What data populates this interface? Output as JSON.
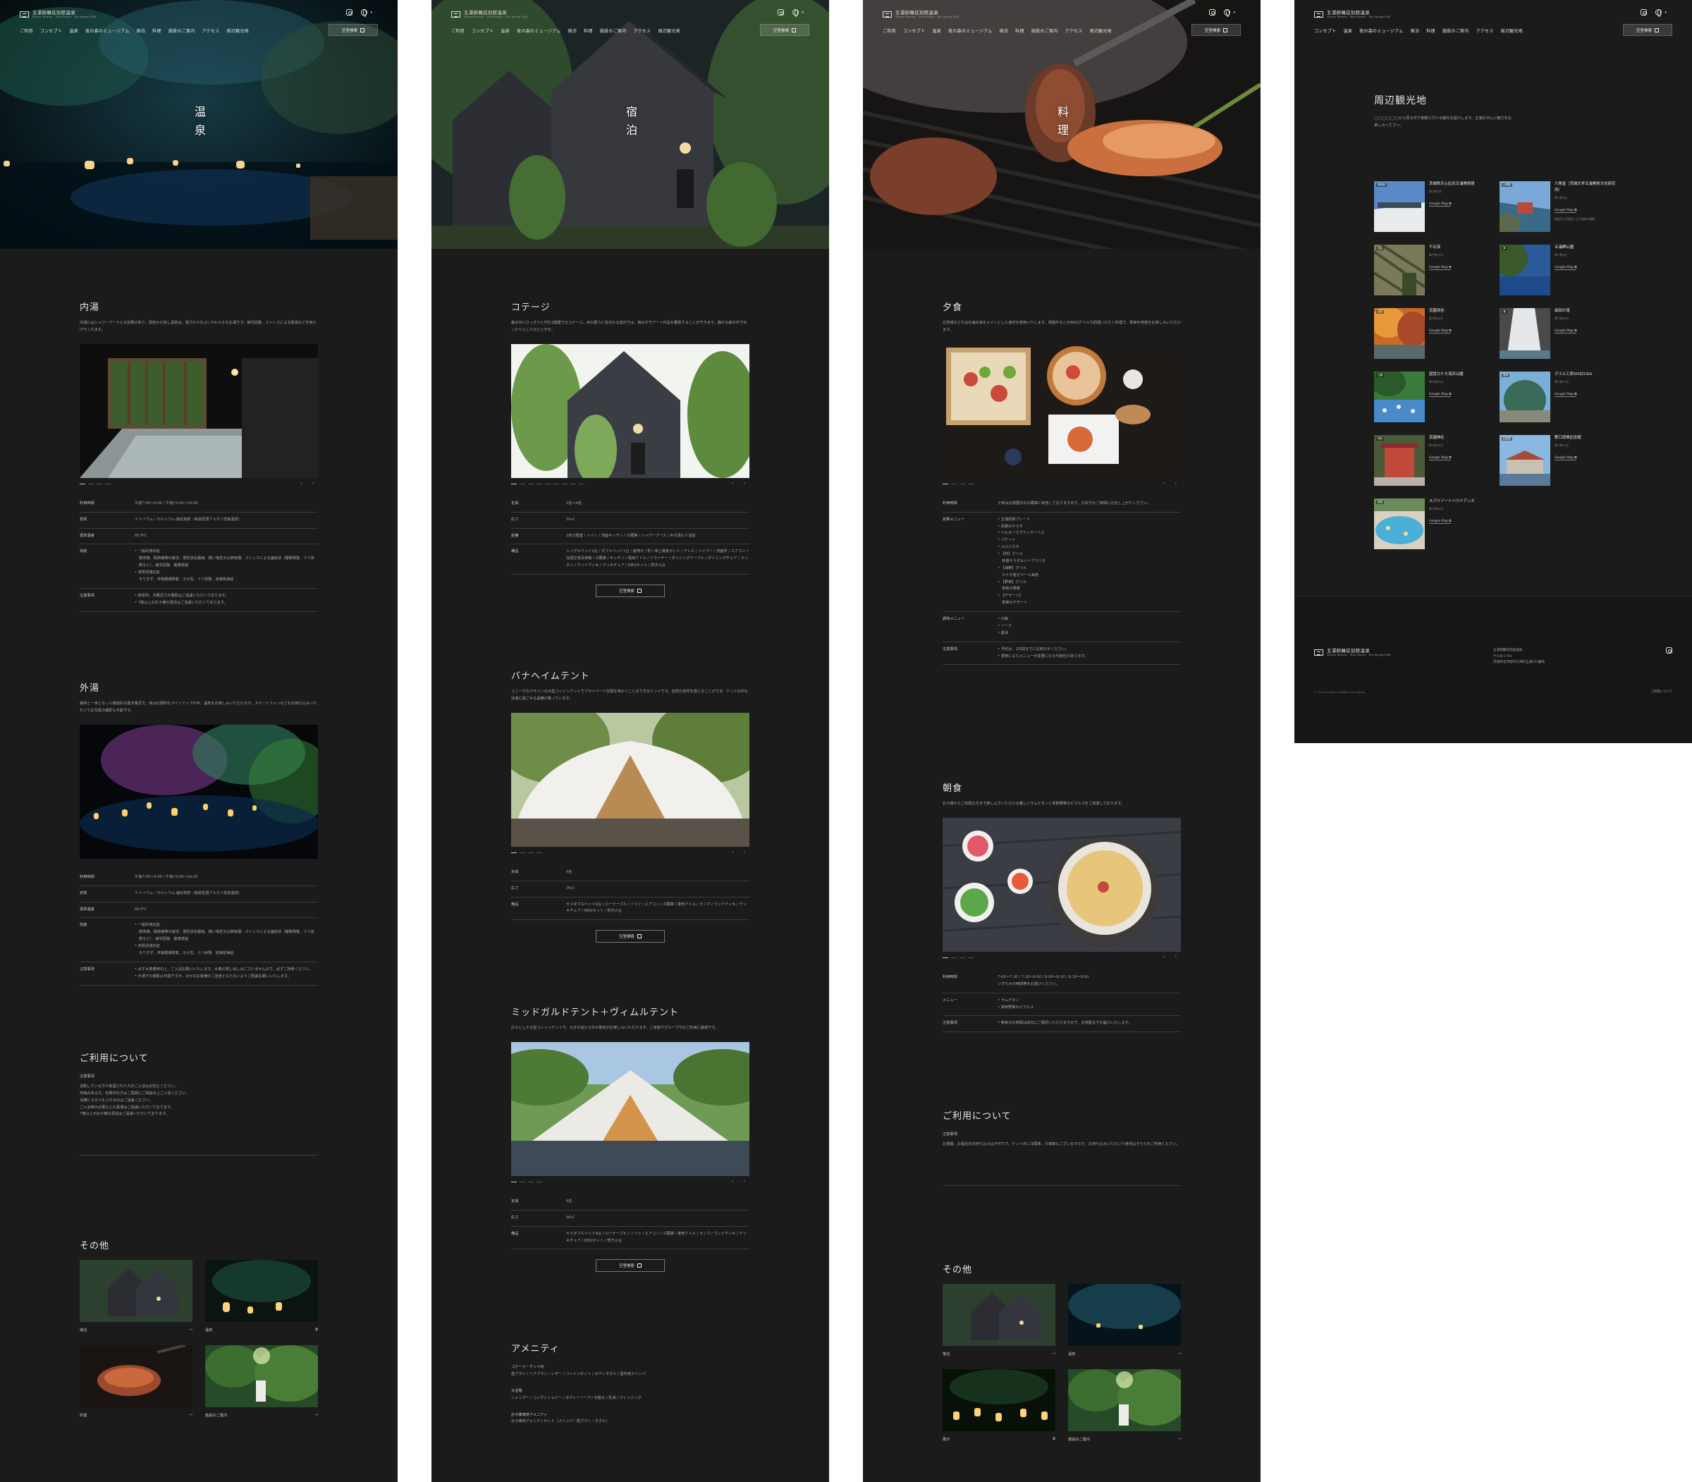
{
  "brand": {
    "name": "五浦俯瞰荘別館温泉",
    "sub": "Nature Retreat · Mori Resort · Hot Spring Villa"
  },
  "nav": [
    "ご利用",
    "コンセプト",
    "温泉",
    "夜の森のミュージアム",
    "宿泊",
    "料理",
    "施設のご案内",
    "アクセス",
    "周辺観光地"
  ],
  "nav_p4": [
    "コンセプト",
    "温泉",
    "夜の森のミュージアム",
    "宿泊",
    "料理",
    "施設のご案内",
    "アクセス",
    "周辺観光地"
  ],
  "vacancy_label": "空室検索",
  "spring": {
    "hero_title": "温泉",
    "inner": {
      "title": "内湯",
      "lead": "内湯にはシャワーブースと大浴場があり、源泉かけ流し温泉は、湯ざわりのよいやわらかなお湯です。疲労回復、ストレスによる緊張などを和らげてくれます。",
      "rows": [
        {
          "k": "利用時間",
          "v": [
            "午前7:00〜9:00 / 午後15:00〜24:00"
          ]
        },
        {
          "k": "泉質",
          "v": [
            "ナトリウム・カルシウム-塩化物泉（高張性弱アルカリ性高温泉）"
          ]
        },
        {
          "k": "源泉温度",
          "v": [
            "60.9℃"
          ]
        },
        {
          "k": "効能",
          "v": [
            "一般的適応症",
            "筋肉痛、関節痛等の疲労、慢性消化器病、軽い喘息又は肺気腫、ストレスによる諸症状（睡眠障害、うつ状態など）、疲労回復、健康増進",
            "泉質別適応症",
            "きりきず、末梢循環障害、冷え性、うつ状態、皮膚乾燥症"
          ]
        },
        {
          "k": "注意事項",
          "v": [
            "飲泉所、内風呂での撮影はご遠慮いただいております。",
            "7歳以上のお子様の混浴はご遠慮いただいております。"
          ]
        }
      ]
    },
    "outer": {
      "title": "外湯",
      "lead": "森林と一体となった開放的な露天風呂で、夜は幻想的なライトアップの中、温泉をお楽しみいただけます。スマートフォンなどをお持ち込みいただいてお写真の撮影も可能です。",
      "rows": [
        {
          "k": "利用時間",
          "v": [
            "午後7:00〜9:00 / 午後15:00〜24:00"
          ]
        },
        {
          "k": "泉質",
          "v": [
            "ナトリウム・カルシウム-塩化物泉（高張性弱アルカリ性高温泉）"
          ]
        },
        {
          "k": "源泉温度",
          "v": [
            "60.9℃"
          ]
        },
        {
          "k": "効能",
          "v": [
            "一般的適応症",
            "筋肉痛、関節痛等の疲労、慢性消化器病、軽い喘息又は肺気腫、ストレスによる諸症状（睡眠障害、うつ状態など）、疲労回復、健康増進",
            "泉質別適応症",
            "きりきず、末梢循環障害、冷え性、うつ状態、皮膚乾燥症"
          ]
        },
        {
          "k": "注意事項",
          "v": [
            "必ず水着着用の上、ご入浴お願いいたします。水着の貸し出しはございませんので、必ずご持参ください。",
            "外湯での撮影は可能ですが、ほかのお客様のご迷惑とならないようご配慮お願いいたします。"
          ]
        }
      ]
    },
    "usage": {
      "title": "ご利用について",
      "note_label": "注意事項",
      "items": [
        "泥酔している方や飲酒された方のご入浴はお控えください。",
        "持病のある方、妊娠中の方はご医師にご相談の上ご入浴ください。",
        "浴槽にタオルを入れるのはご遠慮ください。",
        "ご入浴時の必要以上の長湯はご遠慮いただいております。",
        "7歳以上のお子様の混浴はご遠慮いただいております。"
      ]
    },
    "others_title": "その他",
    "others": [
      "宿泊",
      "温泉",
      "料理",
      "施設のご案内"
    ]
  },
  "stay": {
    "hero_title": "宿泊",
    "cottage": {
      "title": "コテージ",
      "lead": "森の中にひっそりと佇む2階建てのコテージ。木の香りに包まれる室内では、森の中でアート作品を鑑賞することができます。静かな森の中でゆったりとしたひとときを。",
      "rows": [
        {
          "k": "定員",
          "v": [
            "2名〜4名"
          ]
        },
        {
          "k": "広さ",
          "v": [
            "50㎡"
          ]
        },
        {
          "k": "設備",
          "v": [
            "2名分寝室 / トイレ / 洗面キッチン / 冷蔵庫 / シャワーブース / 木の温もり浴室"
          ]
        },
        {
          "k": "備品",
          "v": [
            "シングルベッド2台 / ダブルベッド1台 / 座椅子 / 机 / 卓上電気ポット / テレビ / シャワー / 洗面所 / エアコン / 加湿空気清浄機 / 冷蔵庫 / キッチン / 電気ケトル / ドライヤー / ダイニングテーブル / ダイニングチェア / ランタン / ウッドデッキ / デッキチェア / BBQセット / 焚き火台"
          ]
        }
      ]
    },
    "banahem": {
      "title": "バナヘイムテント",
      "lead": "ユニークなデザインの大型コットンテントでプライベート空間を味わうことのできるテントです。自然の息吹を感じることができ、テントの中も快適に過ごせる設備が整っています。",
      "rows": [
        {
          "k": "定員",
          "v": [
            "4名"
          ]
        },
        {
          "k": "広さ",
          "v": [
            "36㎡"
          ]
        },
        {
          "k": "備品",
          "v": [
            "セミダブルベッド4台 / ローテーブル / ソファ / エアコン / 冷蔵庫 / 電気ケトル / ランプ / ウッドデッキ / デッキチェア / BBQセット / 焚き火台"
          ]
        }
      ]
    },
    "midgard": {
      "title": "ミッドガルドテント＋ヴィムルテント",
      "lead": "広々とした大型コットンテントで、大きな窓から外の景色がお楽しみいただけます。ご家族やグループでのご利用に最適です。",
      "rows": [
        {
          "k": "定員",
          "v": [
            "6名"
          ]
        },
        {
          "k": "広さ",
          "v": [
            "46㎡"
          ]
        },
        {
          "k": "備品",
          "v": [
            "セミダブルベッド4台 / ローテーブル / ソファ / エアコン / 冷蔵庫 / 電気ケトル / ランプ / ウッドデッキ / デッキチェア / BBQセット / 焚き火台"
          ]
        }
      ]
    },
    "amenity": {
      "title": "アメニティ",
      "groups": [
        {
          "k": "コテージ・テント内",
          "v": "歯ブラシ / ヘアブラシ / レザー / コットンセット / ボディタオル / 室内用スリッパ"
        },
        {
          "k": "大浴場",
          "v": "シャンプー / コンディショナー / ボディーソープ / 化粧水 / 乳液 / クレンジング"
        },
        {
          "k": "お子様専用アメニティ",
          "v": "お子様用アメニティセット（スリッパ・歯ブラシ・タオル）"
        }
      ]
    }
  },
  "food": {
    "hero_title": "料理",
    "dinner": {
      "title": "夕食",
      "lead": "北茨城ならではの海の幸をメインとした食材を使用いたします。常陸牛などのBBQグリルで調理いただく料理で、季節の味覚をお楽しみいただけます。",
      "rows": [
        {
          "k": "利用時間",
          "v": [
            "夕食はお部屋内の冷蔵庫に用意しておりますので、お好きなご時間にお召し上がりください。"
          ]
        },
        {
          "k": "前菜メニュー",
          "v": [
            "五浦前菜プレート",
            "前菜のサラダ",
            "ベルオーズブティサーベス",
            "バケット",
            "メロパスタ",
            "【肉】グリル",
            "特選サラダ＆ハーブマリネ",
            "【海鮮】グリル",
            "カナダ産オマール海老",
            "【野菜】グリル",
            "季節の野菜",
            "【デザート】",
            "季節のデザート"
          ]
        },
        {
          "k": "調味メニュー",
          "v": [
            "炒飯",
            "ソース",
            "醤油"
          ]
        },
        {
          "k": "注意事項",
          "v": [
            "予約は、2日前までにお知らせください。",
            "季節によりメニューが変更になる可能性があります。"
          ]
        }
      ]
    },
    "breakfast": {
      "title": "朝食",
      "lead": "お子様からご年配の方まで楽しんでいただける優しいサムゲタンと季節野菜のピクルスをご用意しております。",
      "rows": [
        {
          "k": "利用時間",
          "v": [
            "7:00〜7:30 / 7:30〜8:00 / 8:00〜8:30 / 8:30〜9:00",
            "いずれかの時間帯をお選びください。"
          ]
        },
        {
          "k": "メニュー",
          "v": [
            "サムゲタン",
            "季節野菜のピクルス"
          ]
        },
        {
          "k": "注意事項",
          "v": [
            "朝食のお時間は前日にご選択いただけますので、お部屋までお届けいたします。"
          ]
        }
      ]
    },
    "usage": {
      "title": "ご利用について",
      "note_label": "注意事項",
      "items": [
        "お部屋、お風呂内の持ち込みは不可です。テント内に冷蔵庫、冷凍庫もございますので、お持ち込みいただいた食材はそちらをご利用ください。"
      ]
    },
    "others_title": "その他",
    "others": [
      "宿泊",
      "温泉",
      "展示",
      "施設のご案内"
    ]
  },
  "sights": {
    "title": "周辺観光地",
    "lead": "◯◯◯◯◯◯から見る中で気軽に行ける観光を紹介します。五浦を中心に魅力をお楽しみください。",
    "items": [
      {
        "tag": "美術館",
        "name": "茨城県天心記念五浦美術館",
        "dist": "車で約5分",
        "ex": ""
      },
      {
        "tag": "六角堂",
        "name": "六角堂（茨城大学五浦美術文化研究所）",
        "dist": "車で約5分",
        "ex": "岡倉天心が設計した六角形の建物"
      },
      {
        "tag": "渓谷",
        "name": "千石渓",
        "dist": "車で約15分",
        "ex": ""
      },
      {
        "tag": "海",
        "name": "五浦岬公園",
        "dist": "車で約5分",
        "ex": ""
      },
      {
        "tag": "渓谷",
        "name": "花園渓谷",
        "dist": "車で約30分",
        "ex": ""
      },
      {
        "tag": "滝",
        "name": "袋田の滝",
        "dist": "車で約60分",
        "ex": ""
      },
      {
        "tag": "公園",
        "name": "国営ひたち海浜公園",
        "dist": "車で約60分",
        "ex": ""
      },
      {
        "tag": "施設",
        "name": "ガラス工房SHIZUKA",
        "dist": "車で約20分",
        "ex": ""
      },
      {
        "tag": "神社",
        "name": "花園神社",
        "dist": "車で約30分",
        "ex": ""
      },
      {
        "tag": "記念館",
        "name": "野口雨情記念館",
        "dist": "車で約15分",
        "ex": ""
      },
      {
        "tag": "温泉",
        "name": "スパリゾートハワイアンズ",
        "dist": "車で約45分",
        "ex": ""
      }
    ],
    "gmap_label": "Google Map"
  },
  "footer": {
    "address": [
      "五浦俯瞰荘別館温泉",
      "〒319-1703",
      "茨城県北茨城市大津町五浦303番地"
    ],
    "copyright": "© Itsura Fukanso Bekkan Hot Spring",
    "privacy": "ご利用について"
  },
  "colors": {
    "bg": "#1b1b1b",
    "text": "#d8d6d0",
    "line": "#3b3b3b",
    "footer": "#161616"
  }
}
